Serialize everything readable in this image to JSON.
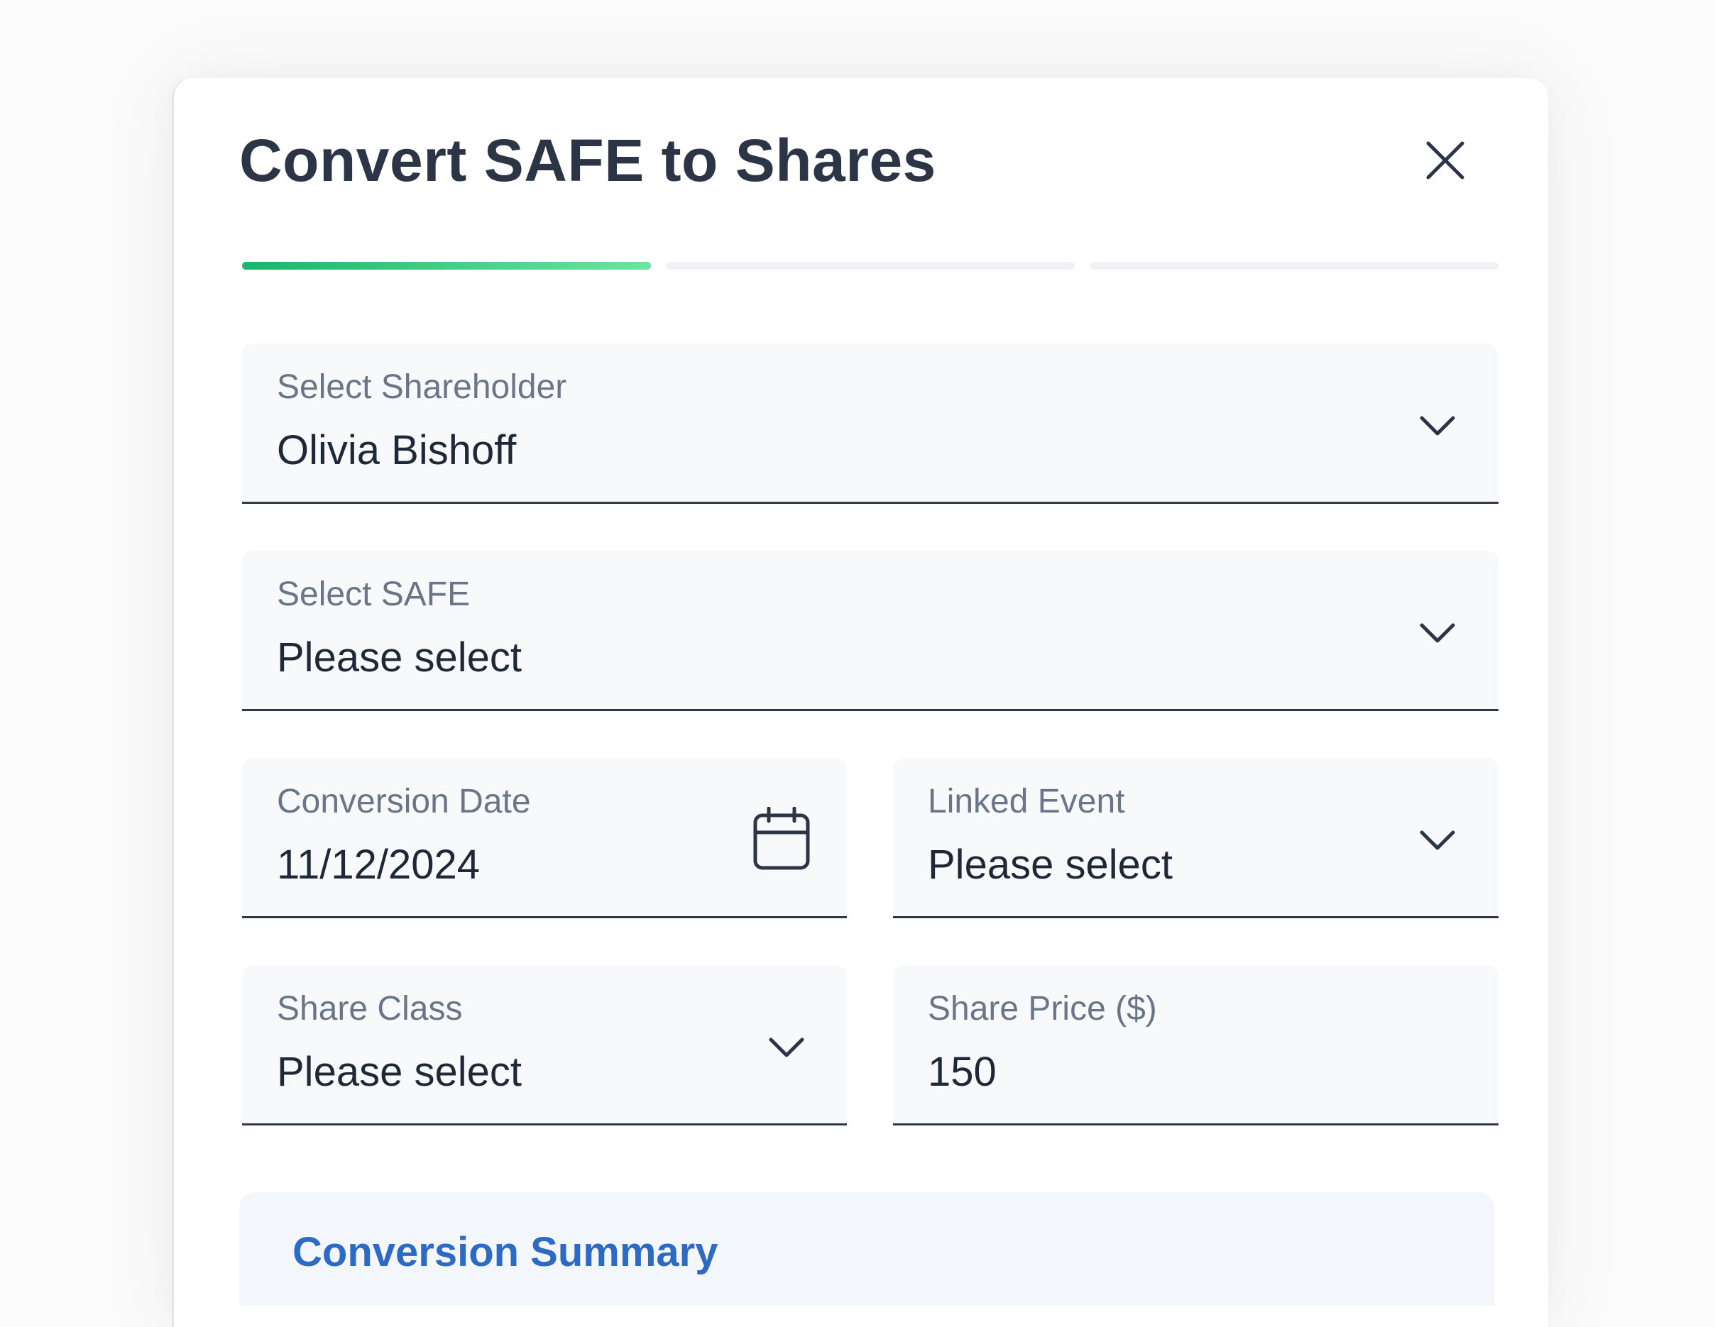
{
  "dialog": {
    "title": "Convert SAFE to Shares",
    "close_label": "Close"
  },
  "stepper": {
    "total_steps": 3,
    "current_step": 1
  },
  "fields": {
    "shareholder": {
      "label": "Select Shareholder",
      "value": "Olivia Bishoff",
      "icon": "chevron-down-icon"
    },
    "safe": {
      "label": "Select SAFE",
      "value": "Please select",
      "icon": "chevron-down-icon"
    },
    "conversion_date": {
      "label": "Conversion Date",
      "value": "11/12/2024",
      "icon": "calendar-icon"
    },
    "linked_event": {
      "label": "Linked Event",
      "value": "Please select",
      "icon": "chevron-down-icon"
    },
    "share_class": {
      "label": "Share Class",
      "value": "Please select",
      "icon": "chevron-down-icon"
    },
    "share_price": {
      "label": "Share Price ($)",
      "value": "150"
    }
  },
  "summary": {
    "title": "Conversion Summary"
  },
  "colors": {
    "progress_active_start": "#1cb569",
    "progress_active_end": "#6ee4a1",
    "progress_inactive": "#f0f2f5",
    "title_text": "#2b3546",
    "summary_accent": "#2c6ac4",
    "field_bg": "#f7f9fb"
  }
}
